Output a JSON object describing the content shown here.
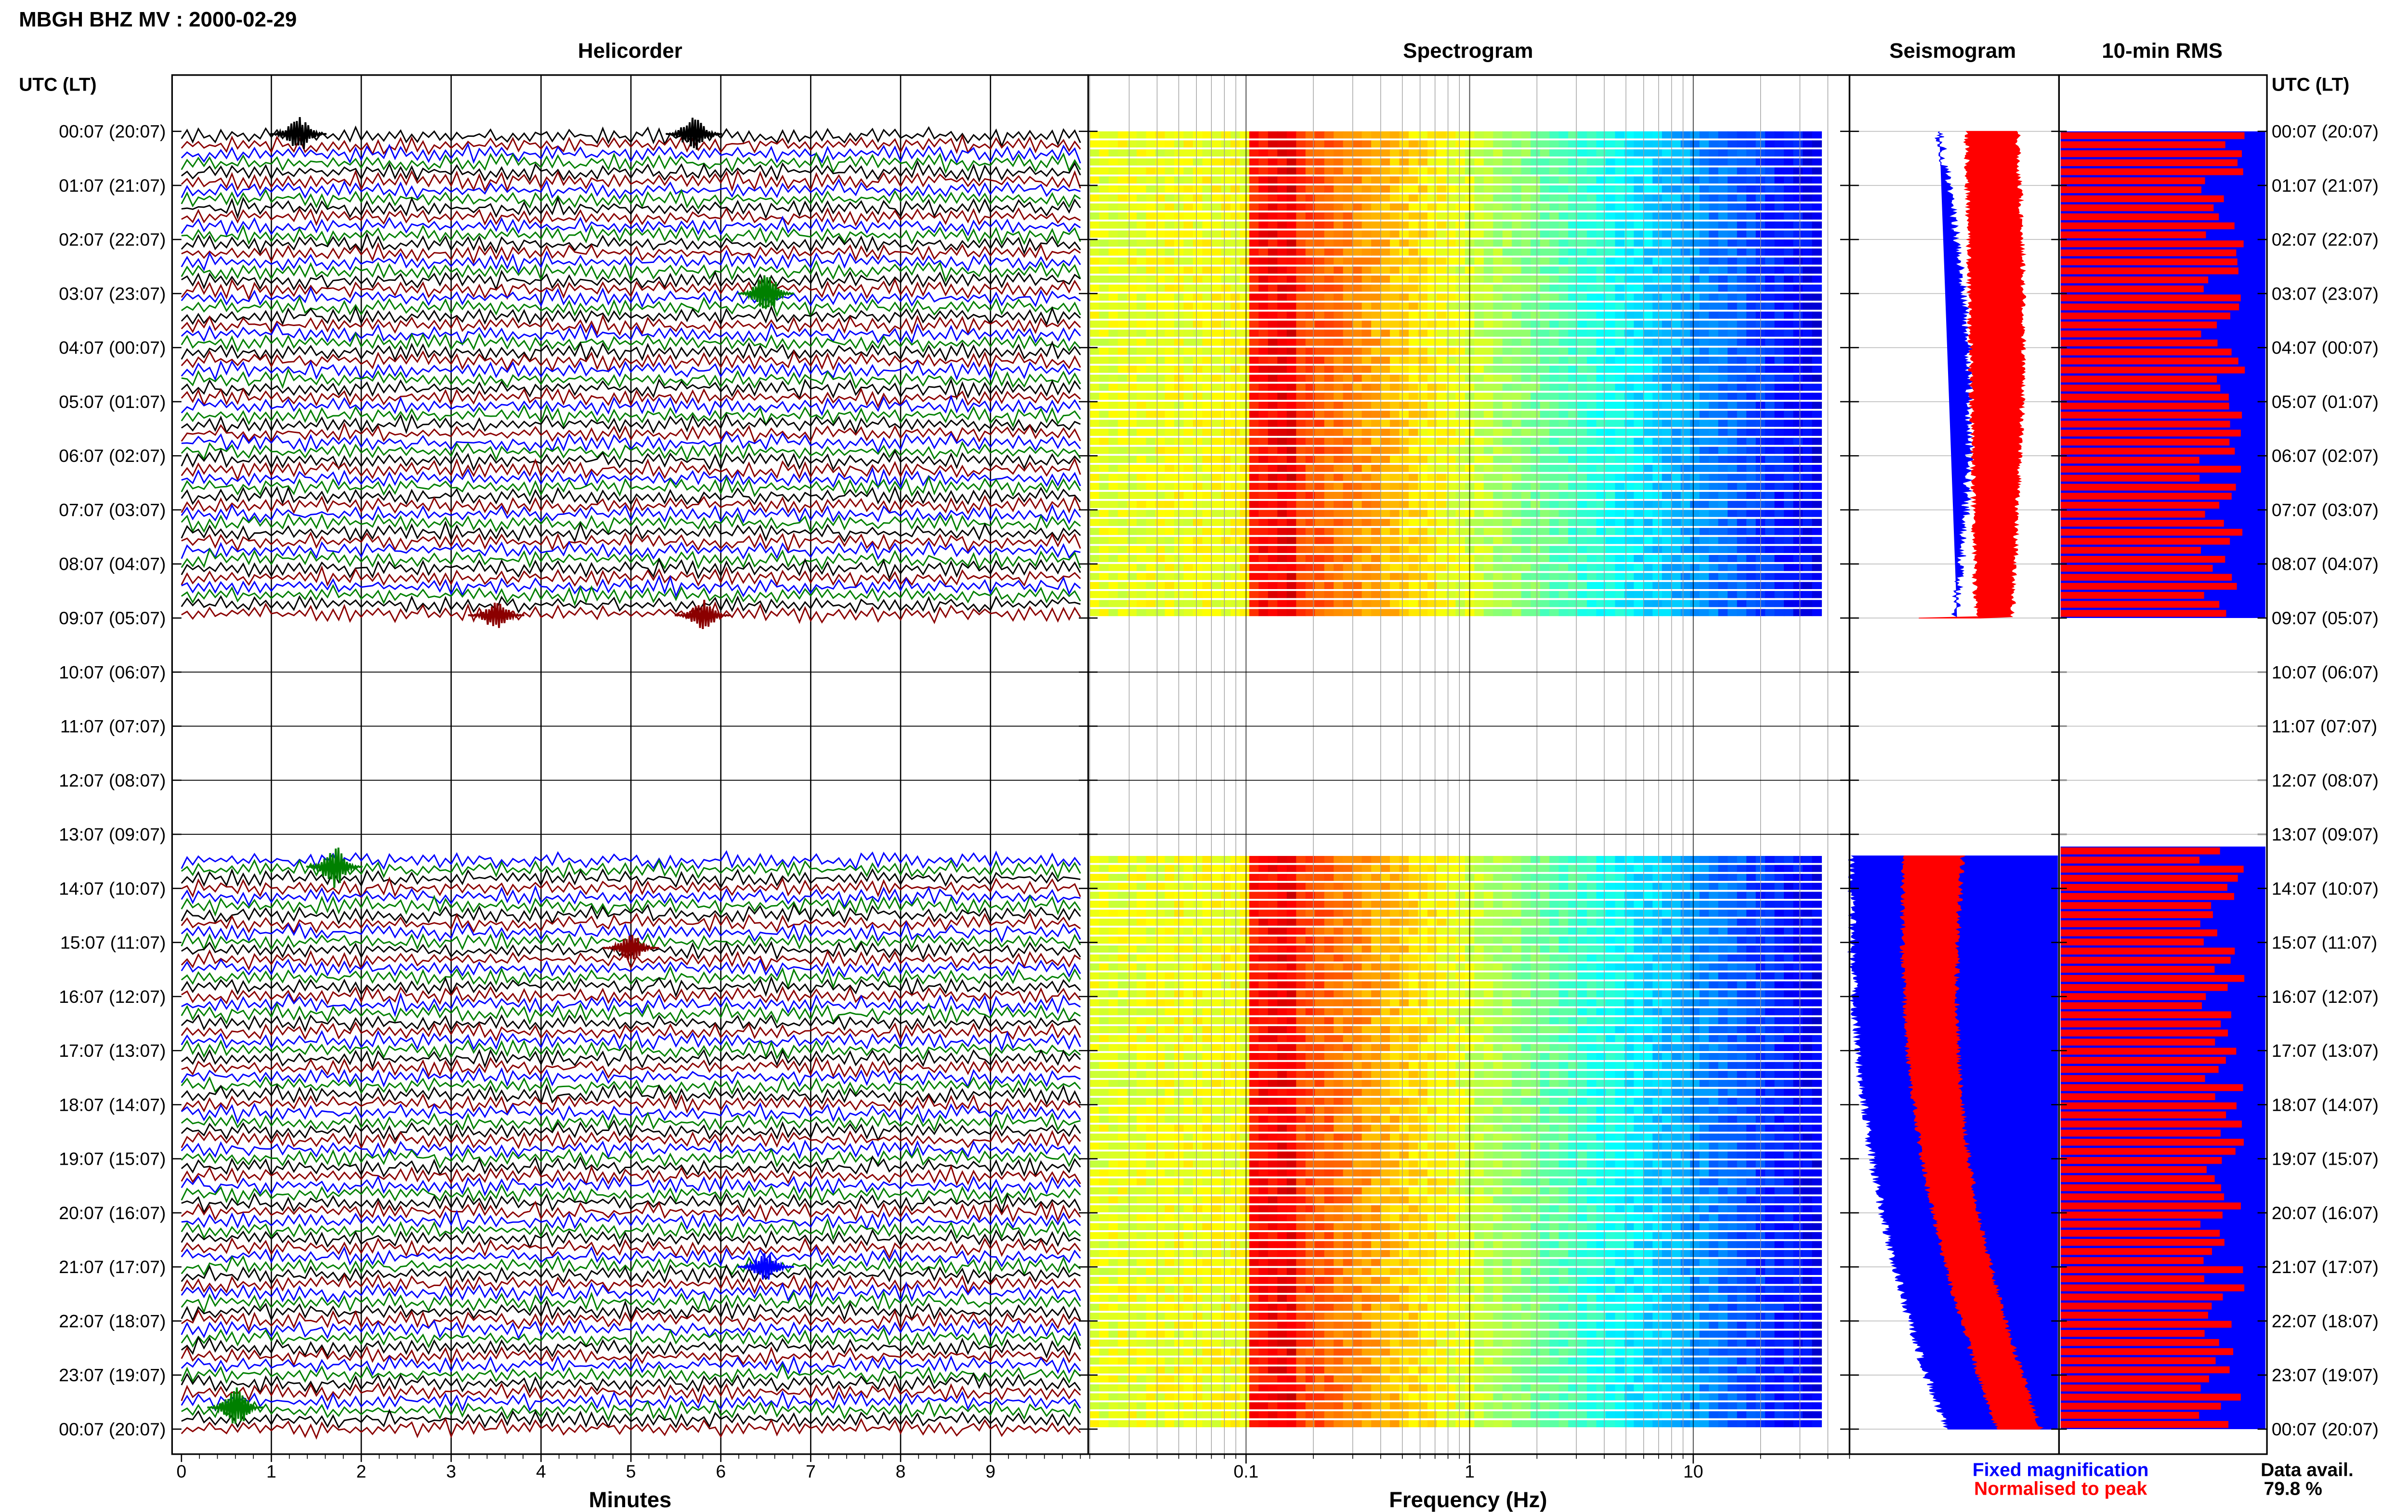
{
  "header": {
    "title": "MBGH BHZ MV : 2000-02-29",
    "time_axis_label": "UTC (LT)"
  },
  "panels": {
    "helicorder": "Helicorder",
    "spectrogram": "Spectrogram",
    "seismogram": "Seismogram",
    "rms": "10-min RMS"
  },
  "legend": {
    "fixed": "Fixed magnification",
    "normalised": "Normalised to peak",
    "fixed_color": "#0000ff",
    "normalised_color": "#ff0000"
  },
  "data_availability": {
    "label": "Data avail.",
    "value": "79.8 %"
  },
  "chart_data": {
    "type": "helicorder",
    "time_labels": [
      "00:07 (20:07)",
      "01:07 (21:07)",
      "02:07 (22:07)",
      "03:07 (23:07)",
      "04:07 (00:07)",
      "05:07 (01:07)",
      "06:07 (02:07)",
      "07:07 (03:07)",
      "08:07 (04:07)",
      "09:07 (05:07)",
      "10:07 (06:07)",
      "11:07 (07:07)",
      "12:07 (08:07)",
      "13:07 (09:07)",
      "14:07 (10:07)",
      "15:07 (11:07)",
      "16:07 (12:07)",
      "17:07 (13:07)",
      "18:07 (14:07)",
      "19:07 (15:07)",
      "20:07 (16:07)",
      "21:07 (17:07)",
      "22:07 (18:07)",
      "23:07 (19:07)",
      "00:07 (20:07)"
    ],
    "data_gaps_hours": [
      [
        9.0,
        13.4
      ]
    ],
    "helicorder": {
      "xlabel": "Minutes",
      "xlim": [
        0,
        10
      ],
      "xticks": [
        "0",
        "1",
        "2",
        "3",
        "4",
        "5",
        "6",
        "7",
        "8",
        "9"
      ],
      "trace_colors": [
        "#000000",
        "#8b0000",
        "#0000ff",
        "#008000"
      ]
    },
    "spectrogram": {
      "xlabel": "Frequency (Hz)",
      "xscale": "log",
      "xlim": [
        0.02,
        50
      ],
      "xticks": [
        "0.1",
        "1",
        "10"
      ],
      "colormap": "jet"
    }
  }
}
